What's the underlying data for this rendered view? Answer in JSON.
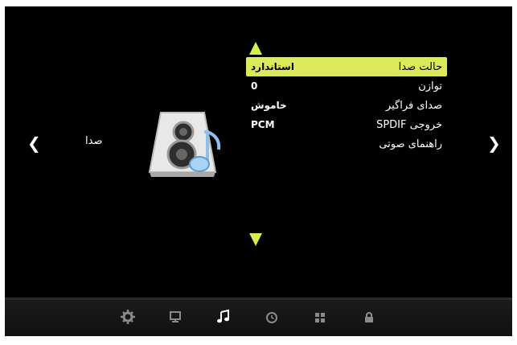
{
  "section": {
    "label": "صدا"
  },
  "menu": {
    "items": [
      {
        "label": "حالت صدا",
        "value": "استاندارد",
        "selected": true
      },
      {
        "label": "توازن",
        "value": "0",
        "selected": false
      },
      {
        "label": "صدای فراگیر",
        "value": "خاموش",
        "selected": false
      },
      {
        "label": "خروجی SPDIF",
        "value": "PCM",
        "selected": false
      },
      {
        "label": "راهنمای صوتی",
        "value": "",
        "selected": false
      }
    ]
  },
  "nav": {
    "icons": [
      "gear-icon",
      "monitor-icon",
      "music-note-icon",
      "clock-icon",
      "apps-grid-icon",
      "lock-icon"
    ],
    "active": "music-note-icon"
  },
  "colors": {
    "highlight": "#dce959",
    "arrow": "#d8ec4a",
    "background": "#000000"
  }
}
